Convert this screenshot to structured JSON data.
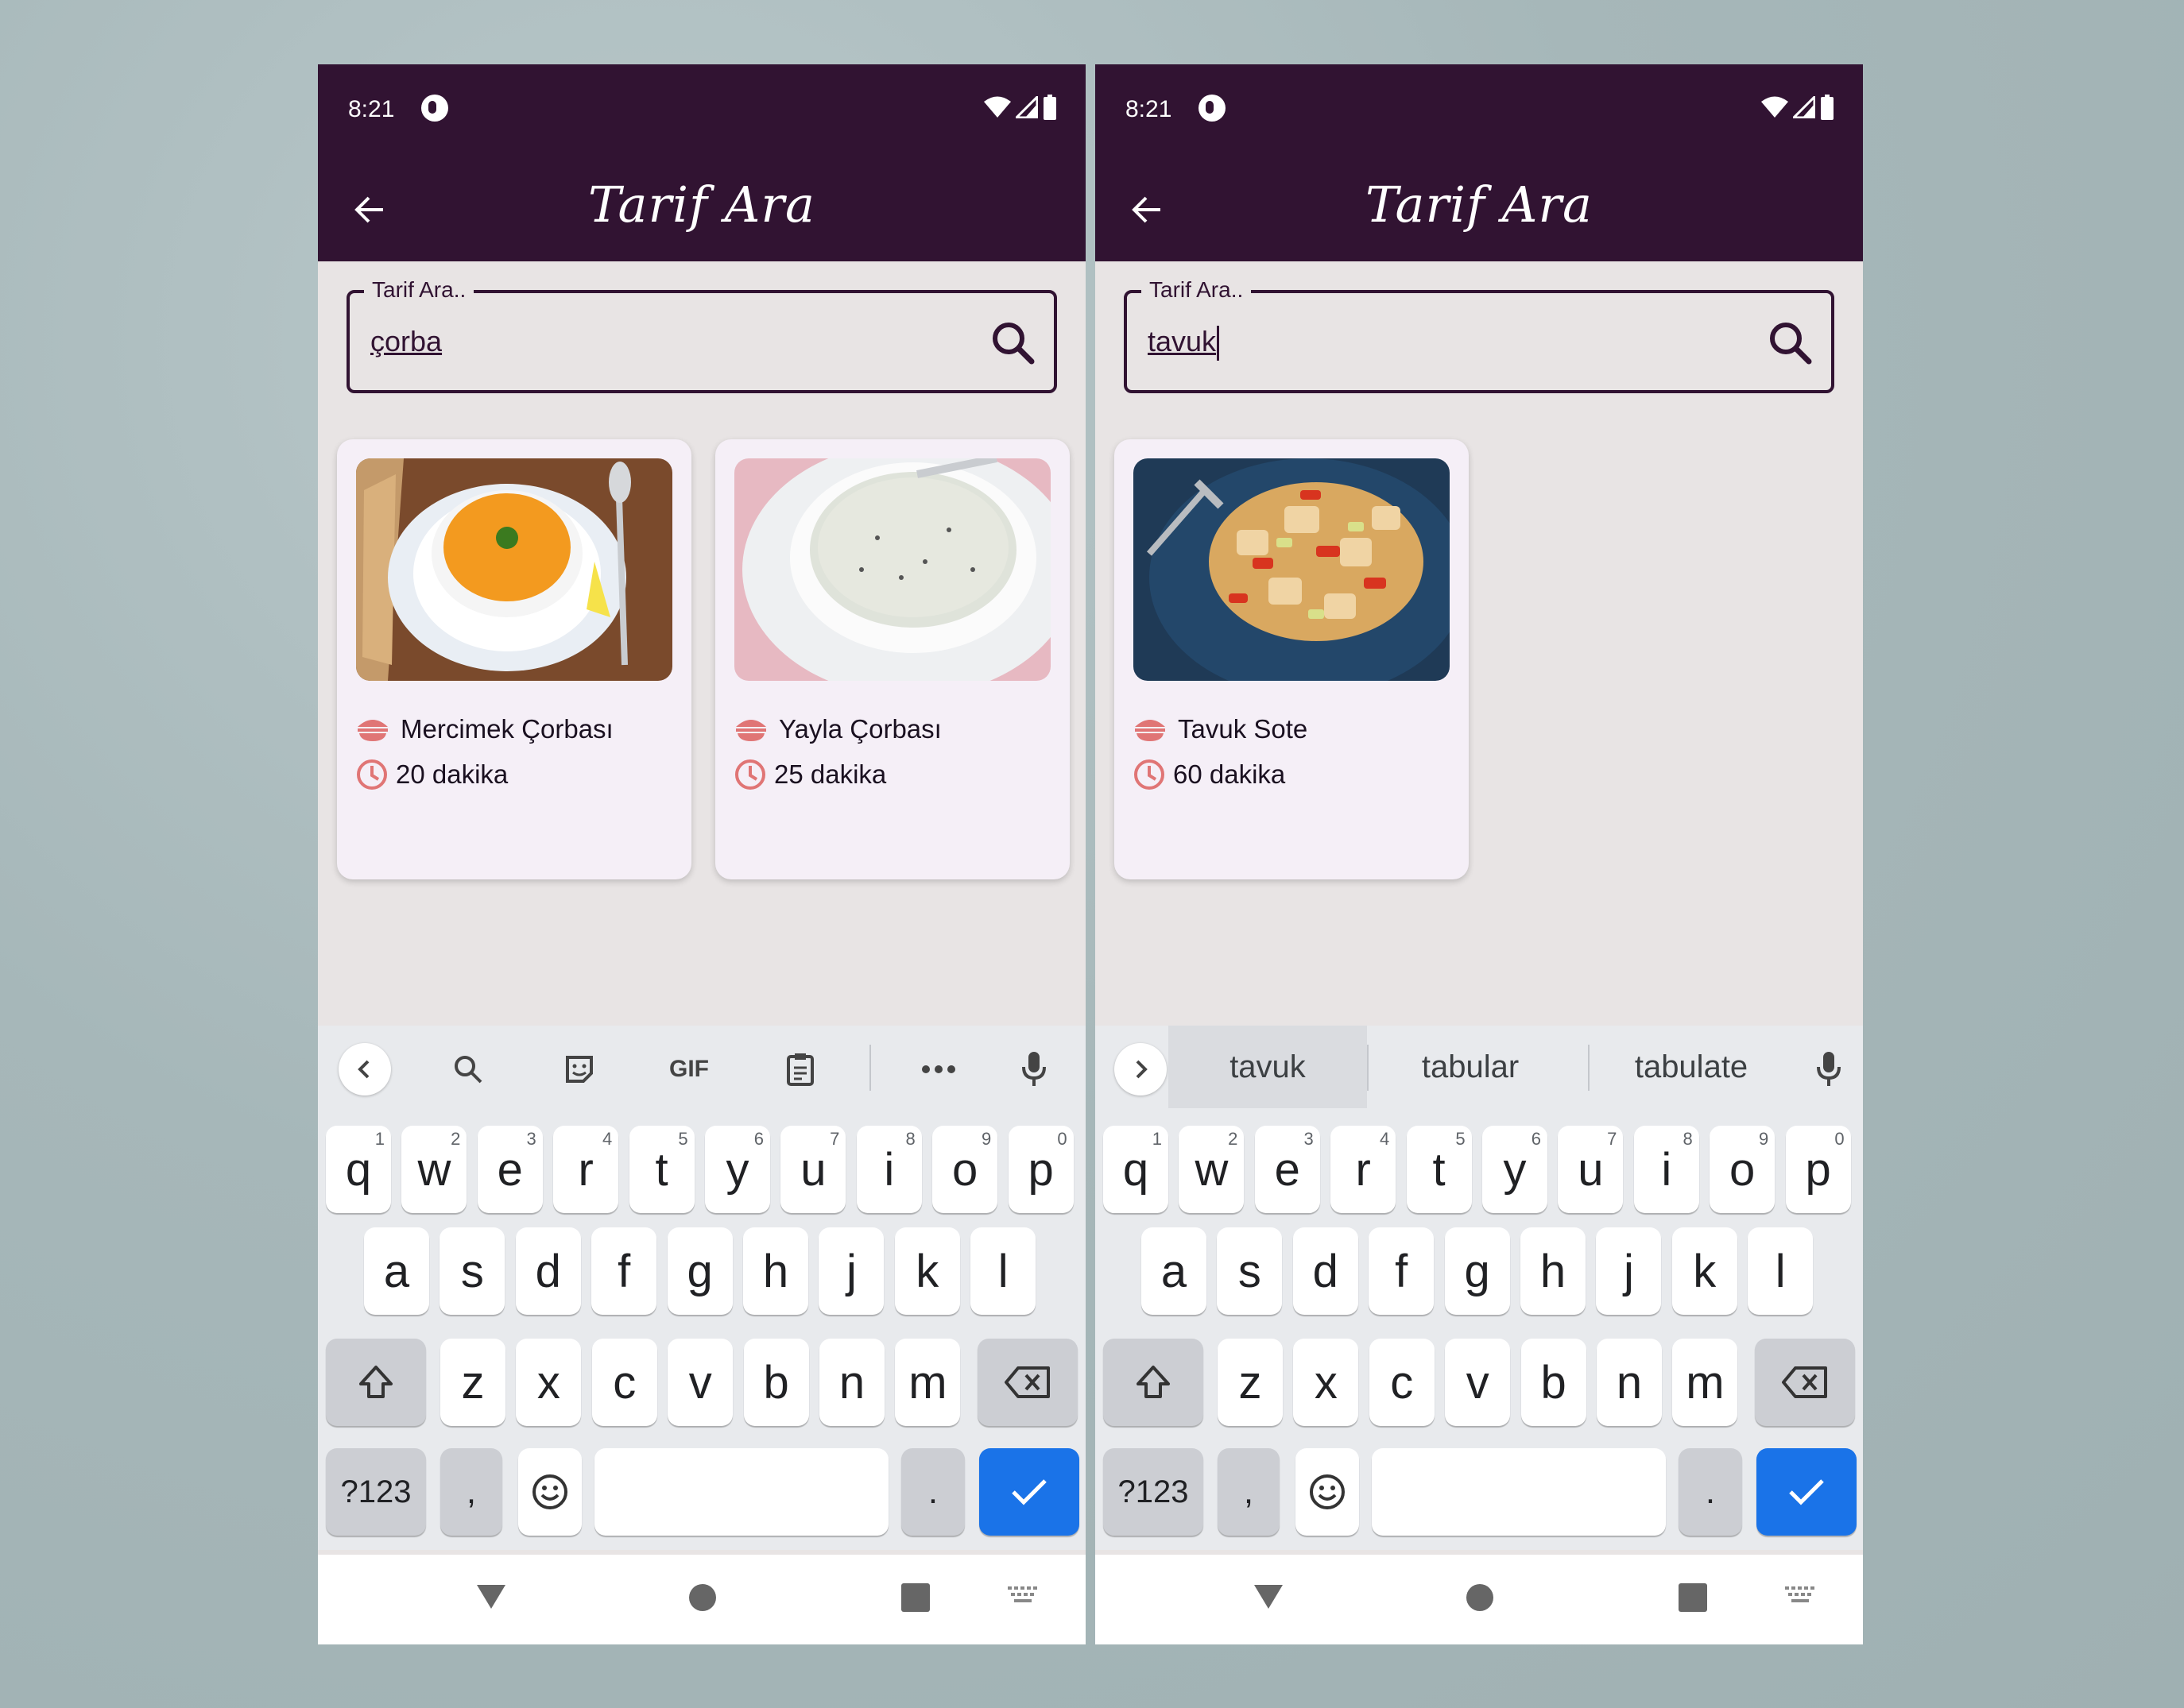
{
  "status": {
    "time": "8:21"
  },
  "header": {
    "title": "Tarif Ara"
  },
  "search": {
    "label": "Tarif Ara.."
  },
  "screens": [
    {
      "query": "çorba",
      "recipes": [
        {
          "name": "Mercimek Çorbası",
          "duration": "20 dakika"
        },
        {
          "name": "Yayla Çorbası",
          "duration": "25 dakika"
        }
      ],
      "keyboard_toolbar": [
        "back",
        "search",
        "sticker",
        "GIF",
        "clipboard",
        "more",
        "mic"
      ]
    },
    {
      "query": "tavuk",
      "recipes": [
        {
          "name": "Tavuk Sote",
          "duration": "60 dakika"
        }
      ],
      "suggestions": [
        "tavuk",
        "tabular",
        "tabulate"
      ]
    }
  ],
  "keyboard": {
    "row1": [
      "q",
      "w",
      "e",
      "r",
      "t",
      "y",
      "u",
      "i",
      "o",
      "p"
    ],
    "row1_hints": [
      "1",
      "2",
      "3",
      "4",
      "5",
      "6",
      "7",
      "8",
      "9",
      "0"
    ],
    "row2": [
      "a",
      "s",
      "d",
      "f",
      "g",
      "h",
      "j",
      "k",
      "l"
    ],
    "row3": [
      "z",
      "x",
      "c",
      "v",
      "b",
      "n",
      "m"
    ],
    "symbols": "?123",
    "comma": ",",
    "period": ".",
    "gif": "GIF"
  },
  "colors": {
    "primary": "#311332",
    "accent": "#e07575",
    "enter": "#1a73e8"
  }
}
